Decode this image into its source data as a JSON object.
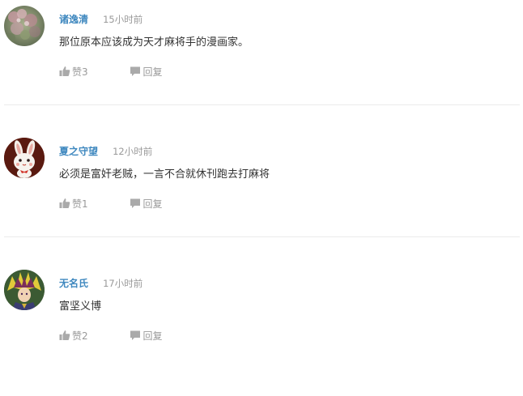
{
  "colors": {
    "username": "#3f88bf",
    "muted": "#999999",
    "text": "#333333",
    "divider": "#ebebeb"
  },
  "comments": [
    {
      "username": "诸逸清",
      "time": "15小时前",
      "content": "那位原本应该成为天才麻将手的漫画家。",
      "like_label": "赞3",
      "reply_label": "回复",
      "avatar": "avatar-blossom-photo"
    },
    {
      "username": "夏之守望",
      "time": "12小时前",
      "content": "必须是富奸老贼，一言不合就休刊跑去打麻将",
      "like_label": "赞1",
      "reply_label": "回复",
      "avatar": "avatar-bunny-cartoon"
    },
    {
      "username": "无名氏",
      "time": "17小时前",
      "content": "富坚义博",
      "like_label": "赞2",
      "reply_label": "回复",
      "avatar": "avatar-anime-character"
    }
  ]
}
